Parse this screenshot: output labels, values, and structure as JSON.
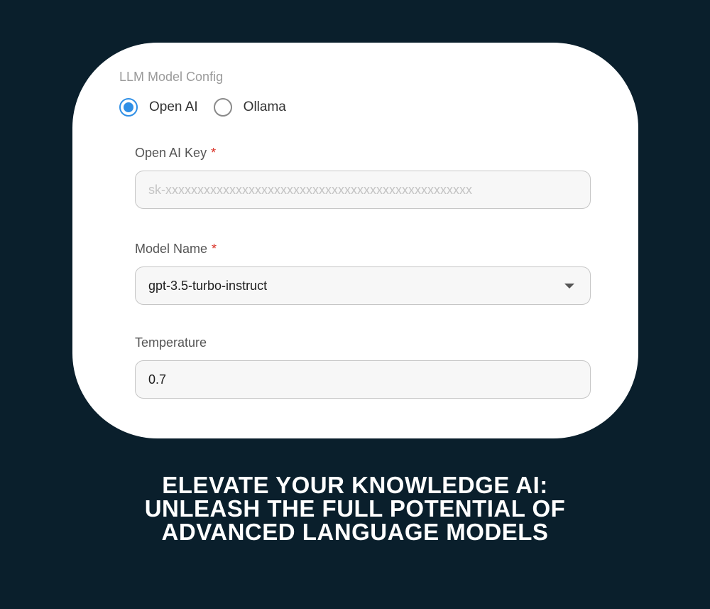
{
  "config": {
    "section_title": "LLM Model Config",
    "provider_options": [
      {
        "label": "Open AI",
        "selected": true
      },
      {
        "label": "Ollama",
        "selected": false
      }
    ],
    "api_key": {
      "label": "Open AI Key",
      "required_mark": "*",
      "placeholder": "sk-xxxxxxxxxxxxxxxxxxxxxxxxxxxxxxxxxxxxxxxxxxxxxxxx",
      "value": ""
    },
    "model_name": {
      "label": "Model Name",
      "required_mark": "*",
      "selected": "gpt-3.5-turbo-instruct"
    },
    "temperature": {
      "label": "Temperature",
      "value": "0.7"
    }
  },
  "headline": {
    "lines": [
      "ELEVATE YOUR KNOWLEDGE AI:",
      "UNLEASH THE FULL POTENTIAL OF",
      "ADVANCED LANGUAGE MODELS"
    ]
  },
  "colors": {
    "background": "#0a1f2c",
    "card": "#ffffff",
    "accent": "#2f8fe6",
    "required": "#d93025"
  },
  "icons": {
    "dropdown": "chevron-down-icon"
  }
}
